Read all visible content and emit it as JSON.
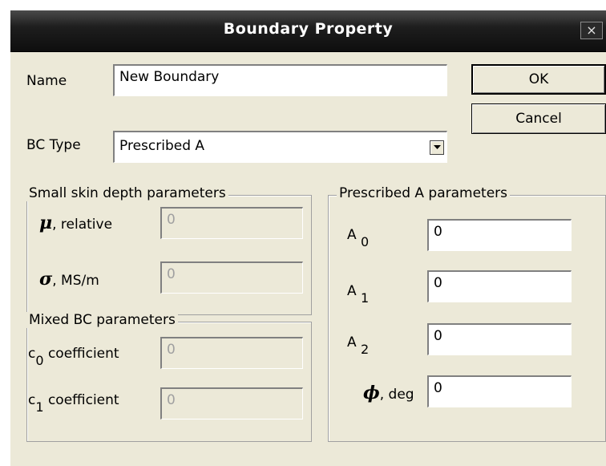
{
  "window": {
    "title": "Boundary Property",
    "close_glyph": "×"
  },
  "name": {
    "label": "Name",
    "value": "New Boundary"
  },
  "buttons": {
    "ok": "OK",
    "cancel": "Cancel"
  },
  "bc_type": {
    "label": "BC Type",
    "selected": "Prescribed A"
  },
  "skin_depth": {
    "title": "Small skin depth parameters",
    "mu": {
      "symbol": "μ",
      "label": ", relative",
      "value": "0"
    },
    "sigma": {
      "symbol": "σ",
      "label": ", MS/m",
      "value": "0"
    }
  },
  "mixed_bc": {
    "title": "Mixed BC parameters",
    "c0": {
      "base": "c",
      "sub": "0",
      "label": "coefficient",
      "value": "0"
    },
    "c1": {
      "base": "c",
      "sub": "1",
      "label": "coefficient",
      "value": "0"
    }
  },
  "prescribed_a": {
    "title": "Prescribed A parameters",
    "a0": {
      "base": "A",
      "sub": "0",
      "value": "0"
    },
    "a1": {
      "base": "A",
      "sub": "1",
      "value": "0"
    },
    "a2": {
      "base": "A",
      "sub": "2",
      "value": "0"
    },
    "phi": {
      "symbol": "ϕ",
      "label": ", deg",
      "value": "0"
    }
  },
  "icons": {
    "close": "close-icon",
    "dropdown": "chevron-down-icon"
  }
}
